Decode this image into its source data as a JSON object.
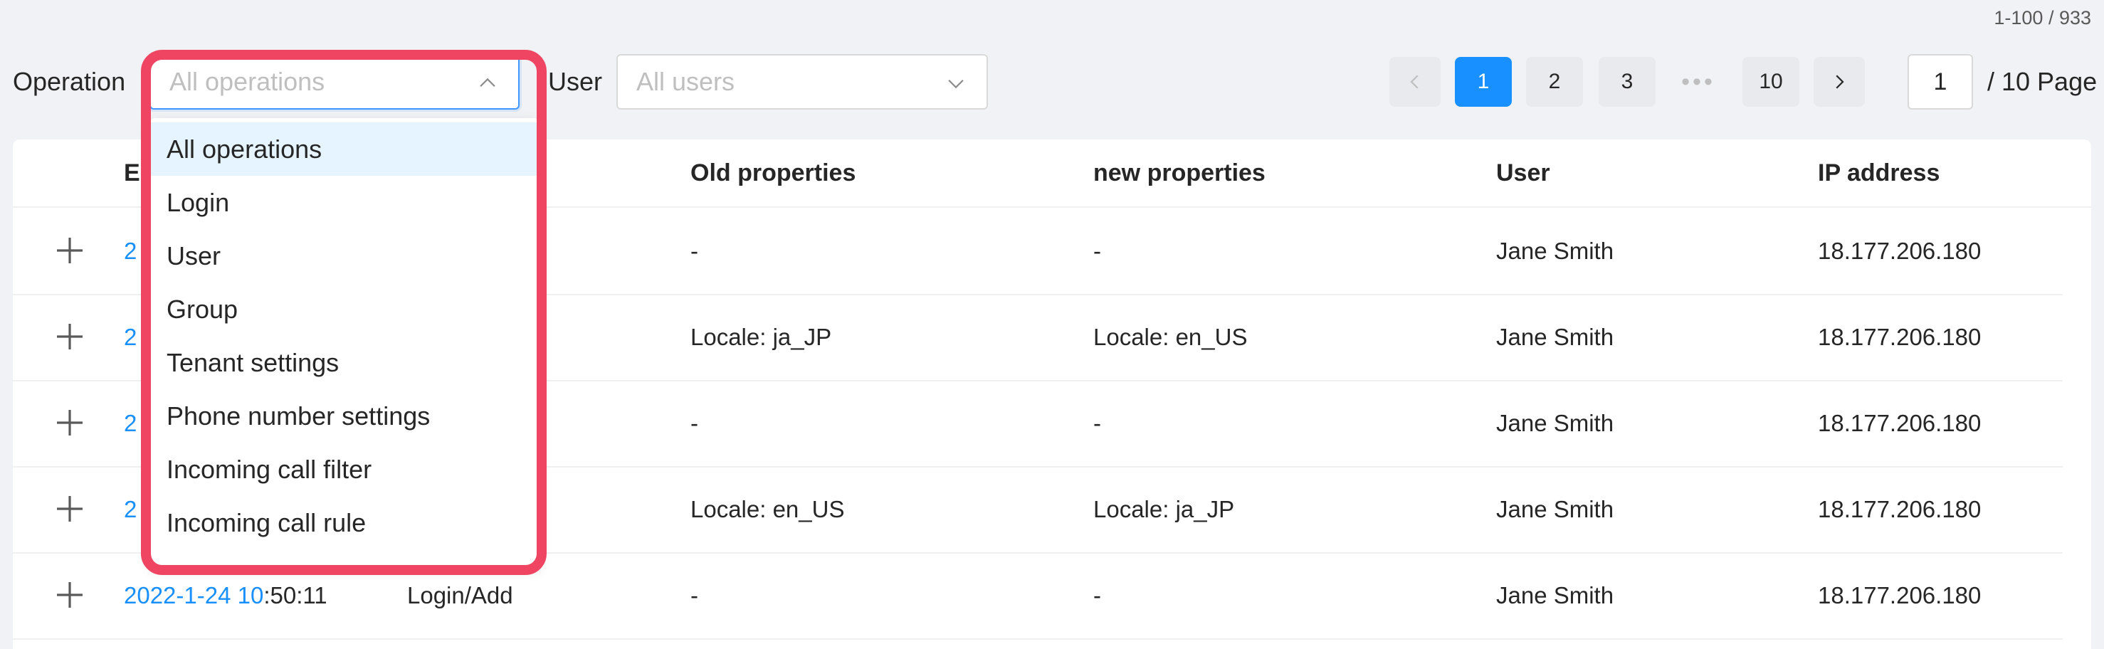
{
  "range_count": "1-100 / 933",
  "filters": {
    "operation_label": "Operation",
    "operation_placeholder": "All operations",
    "user_label": "User",
    "user_placeholder": "All users"
  },
  "pagination": {
    "prev_icon": "chevron-left-icon",
    "pages": [
      "1",
      "2",
      "3",
      "•••",
      "10"
    ],
    "current": "1",
    "next_icon": "chevron-right-icon",
    "jump_value": "1",
    "jump_suffix": "/ 10 Page"
  },
  "dropdown": {
    "options": [
      "All operations",
      "Login",
      "User",
      "Group",
      "Tenant settings",
      "Phone number settings",
      "Incoming call filter",
      "Incoming call rule"
    ],
    "selected": "All operations"
  },
  "table": {
    "headers": {
      "datetime": "E",
      "old": "Old properties",
      "new": "new properties",
      "user": "User",
      "ip": "IP address"
    },
    "rows": [
      {
        "dt_link": "2",
        "dt_rest": "",
        "operation": "",
        "old": "-",
        "new": "-",
        "user": "Jane Smith",
        "ip": "18.177.206.180"
      },
      {
        "dt_link": "2",
        "dt_rest": "",
        "operation": "",
        "old": "Locale: ja_JP",
        "new": "Locale: en_US",
        "user": "Jane Smith",
        "ip": "18.177.206.180"
      },
      {
        "dt_link": "2",
        "dt_rest": "",
        "operation": "",
        "old": "-",
        "new": "-",
        "user": "Jane Smith",
        "ip": "18.177.206.180"
      },
      {
        "dt_link": "2",
        "dt_rest": "",
        "operation": "",
        "old": "Locale: en_US",
        "new": "Locale: ja_JP",
        "user": "Jane Smith",
        "ip": "18.177.206.180"
      },
      {
        "dt_link": "2022-1-24 10",
        "dt_rest": ":50:11",
        "operation": "Login/Add",
        "old": "-",
        "new": "-",
        "user": "Jane Smith",
        "ip": "18.177.206.180"
      }
    ]
  },
  "colors": {
    "accent": "#1890ff",
    "highlight_border": "#ef4562",
    "selected_option_bg": "#e6f4ff"
  }
}
